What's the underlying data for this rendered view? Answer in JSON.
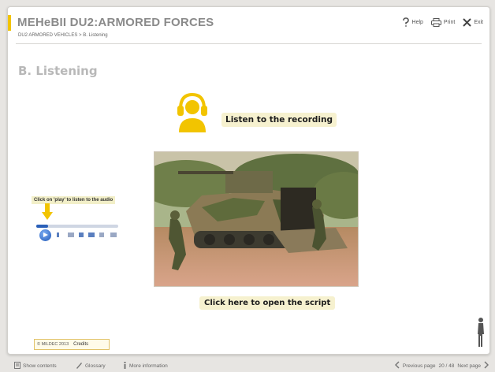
{
  "header": {
    "title": "MEHeBII  DU2:ARMORED FORCES",
    "breadcrumb": "DU2 ARMORED VEHICLES > B. Listening",
    "help_label": "Help",
    "print_label": "Print",
    "exit_label": "Exit"
  },
  "main": {
    "section_title": "B. Listening",
    "listen_label": "Listen to the recording",
    "audio_hint": "Click on 'play' to listen to the audio",
    "script_label": "Click here to open the script",
    "audio_progress": 0.14
  },
  "footer": {
    "copyright": "© MILDEC 2013",
    "credits_label": "Credits",
    "show_contents": "Show contents",
    "glossary": "Glossary",
    "more_info": "More information",
    "previous_page": "Previous page",
    "page_counter": "20 / 48",
    "next_page": "Next page"
  },
  "colors": {
    "accent": "#f2c400",
    "label_background": "#f6f1cf",
    "player_blue": "#1e56b5",
    "title_gray": "#8a8a8a"
  },
  "icons": [
    "help-icon",
    "print-icon",
    "exit-icon",
    "headset-icon",
    "arrow-down-icon",
    "play-icon",
    "soldier-icon",
    "contents-icon",
    "glossary-icon",
    "info-icon",
    "chevron-left-icon",
    "chevron-right-icon"
  ]
}
